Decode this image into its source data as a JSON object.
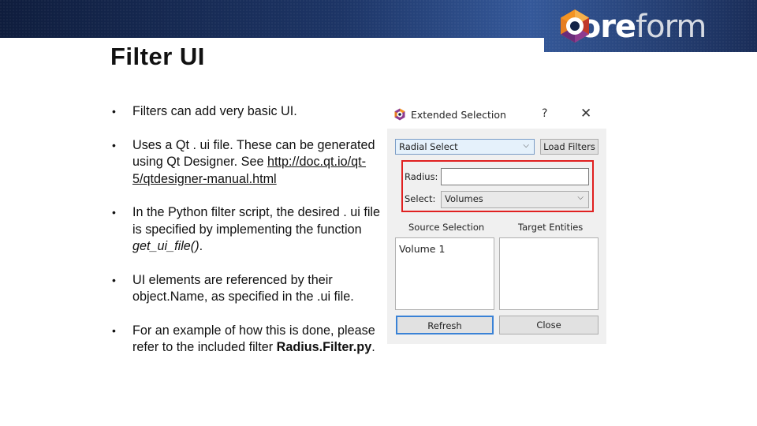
{
  "header": {
    "logo_prefix": "core",
    "logo_suffix": "form",
    "colors": {
      "banner_dark": "#142447",
      "banner_mid": "#2b4b8a",
      "logo_orange": "#f39322",
      "logo_purple": "#8e3a8f"
    }
  },
  "slide": {
    "title": "Filter UI",
    "bullets": {
      "b1": "Filters can add very basic UI.",
      "b2_text": "Uses a Qt . ui file. These can be generated using Qt Designer. See ",
      "b2_link": "http://doc.qt.io/qt-5/qtdesigner-manual.html",
      "b3_text": "In the Python filter script, the desired . ui file is specified by implementing the function ",
      "b3_func": "get_ui_file()",
      "b3_end": ".",
      "b4": "UI elements are referenced by their object.Name, as specified in the .ui file.",
      "b5_text": "For an example of how this is done, please refer to the included filter ",
      "b5_file": "Radius.Filter.py",
      "b5_end": "."
    }
  },
  "dialog": {
    "title": "Extended Selection",
    "help": "?",
    "close_glyph": "✕",
    "filter_value": "Radial Select",
    "load_filters": "Load Filters",
    "radius_label": "Radius:",
    "radius_value": "",
    "select_label": "Select:",
    "select_value": "Volumes",
    "source_header": "Source Selection",
    "target_header": "Target Entities",
    "source_items": [
      "Volume 1"
    ],
    "refresh": "Refresh",
    "close": "Close",
    "highlight_color": "#e02020"
  }
}
